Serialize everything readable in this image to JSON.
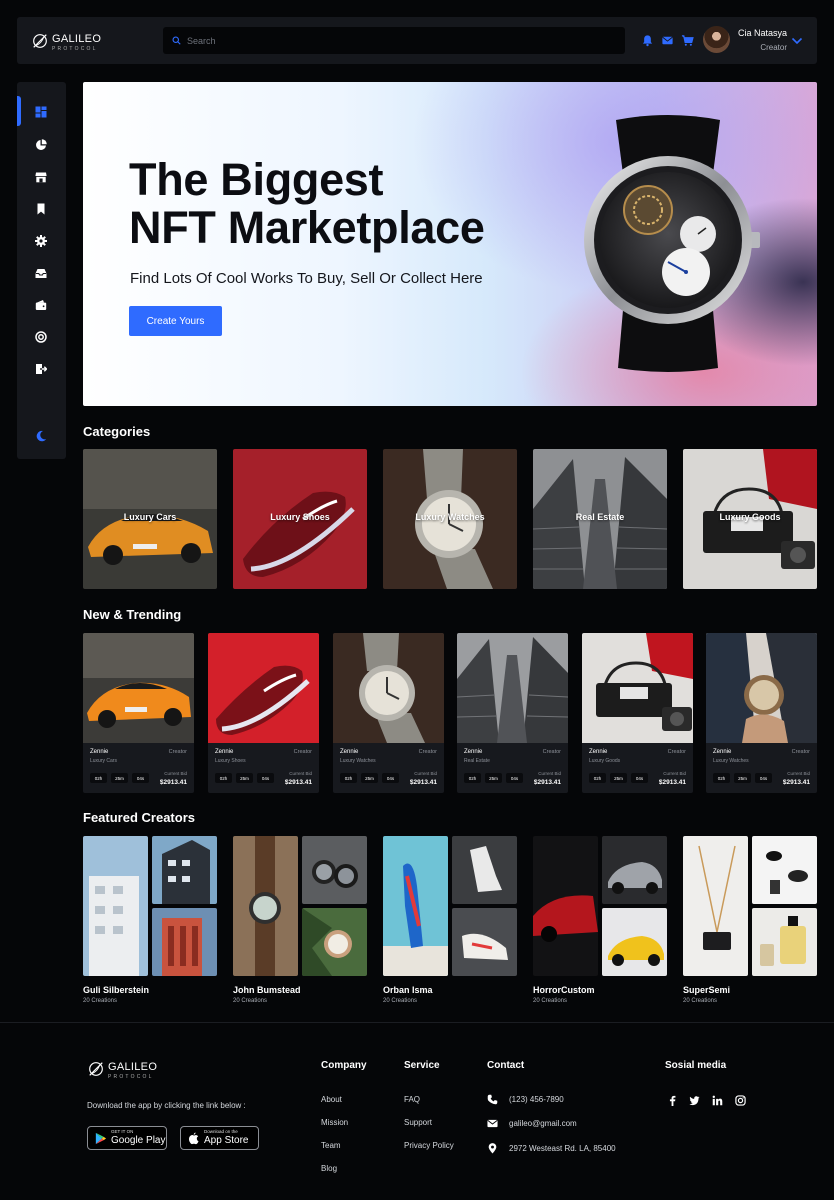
{
  "brand": {
    "name": "GALILEO",
    "tagline": "PROTOCOL"
  },
  "header": {
    "search_placeholder": "Search",
    "user": {
      "name": "Cia Natasya",
      "role": "Creator"
    }
  },
  "colors": {
    "accent": "#2f6bff",
    "panel": "#15171c",
    "background": "#050608"
  },
  "sidebar": {
    "items": [
      {
        "icon": "dashboard-icon",
        "active": true
      },
      {
        "icon": "pie-chart-icon"
      },
      {
        "icon": "store-icon"
      },
      {
        "icon": "bookmark-icon"
      },
      {
        "icon": "settings-icon"
      },
      {
        "icon": "inbox-icon"
      },
      {
        "icon": "wallet-icon"
      },
      {
        "icon": "support-icon"
      },
      {
        "icon": "logout-icon"
      },
      {
        "icon": "moon-icon"
      }
    ]
  },
  "hero": {
    "title_line1": "The Biggest",
    "title_line2": "NFT Marketplace",
    "subtitle": "Find Lots Of Cool Works To Buy, Sell Or Collect Here",
    "cta": "Create Yours"
  },
  "categories": {
    "title": "Categories",
    "items": [
      "Luxury Cars",
      "Luxury Shoes",
      "Luxury Watches",
      "Real Estate",
      "Luxury Goods"
    ]
  },
  "trending": {
    "title": "New & Trending",
    "bid_label": "Current Bid",
    "items": [
      {
        "name": "Zennie",
        "role": "Creator",
        "category": "Luxury Cars",
        "h": "02h",
        "m": "25m",
        "s": "04s",
        "bid": "$2913.41"
      },
      {
        "name": "Zennie",
        "role": "Creator",
        "category": "Luxury Shoes",
        "h": "02h",
        "m": "25m",
        "s": "04s",
        "bid": "$2913.41"
      },
      {
        "name": "Zennie",
        "role": "Creator",
        "category": "Luxury Watches",
        "h": "02h",
        "m": "25m",
        "s": "04s",
        "bid": "$2913.41"
      },
      {
        "name": "Zennie",
        "role": "Creator",
        "category": "Real Estate",
        "h": "02h",
        "m": "25m",
        "s": "04s",
        "bid": "$2913.41"
      },
      {
        "name": "Zennie",
        "role": "Creator",
        "category": "Luxury Goods",
        "h": "02h",
        "m": "25m",
        "s": "04s",
        "bid": "$2913.41"
      },
      {
        "name": "Zennie",
        "role": "Creator",
        "category": "Luxury Watches",
        "h": "02h",
        "m": "25m",
        "s": "04s",
        "bid": "$2913.41"
      }
    ]
  },
  "creators": {
    "title": "Featured Creators",
    "items": [
      {
        "name": "Guli Silberstein",
        "count": "20 Creations"
      },
      {
        "name": "John Bumstead",
        "count": "20 Creations"
      },
      {
        "name": "Orban Isma",
        "count": "20 Creations"
      },
      {
        "name": "HorrorCustom",
        "count": "20 Creations"
      },
      {
        "name": "SuperSemi",
        "count": "20 Creations"
      }
    ]
  },
  "footer": {
    "download_text": "Download the app by clicking the link below :",
    "google_small": "GET IT ON",
    "google_big": "Google Play",
    "apple_small": "Download on the",
    "apple_big": "App Store",
    "company": {
      "title": "Company",
      "links": [
        "About",
        "Mission",
        "Team",
        "Blog"
      ]
    },
    "service": {
      "title": "Service",
      "links": [
        "FAQ",
        "Support",
        "Privacy Policy"
      ]
    },
    "contact": {
      "title": "Contact",
      "phone": "(123) 456-7890",
      "email": "galileo@gmail.com",
      "address": "2972 Westeast Rd. LA, 85400"
    },
    "social": {
      "title": "Sosial media",
      "icons": [
        "facebook-icon",
        "twitter-icon",
        "linkedin-icon",
        "instagram-icon"
      ]
    }
  }
}
